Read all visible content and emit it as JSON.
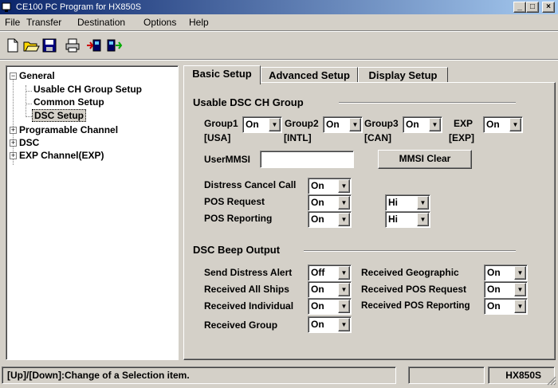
{
  "window": {
    "title": "CE100  PC Program for HX850S"
  },
  "menu": [
    {
      "label": "File"
    },
    {
      "label": "Transfer"
    },
    {
      "label": "Destination"
    },
    {
      "label": "Options"
    },
    {
      "label": "Help"
    }
  ],
  "tree": {
    "general": "General",
    "usable_ch": "Usable CH Group Setup",
    "common": "Common Setup",
    "dsc_setup": "DSC Setup",
    "programable": "Programable Channel",
    "dsc": "DSC",
    "exp": "EXP Channel(EXP)",
    "expander_minus": "−",
    "expander_plus": "+"
  },
  "tabs": {
    "basic": "Basic Setup",
    "advanced": "Advanced Setup",
    "display": "Display Setup"
  },
  "usable_group": {
    "title": "Usable DSC CH Group",
    "group1_label": "Group1",
    "group1_value": "On",
    "group1_sub": "[USA]",
    "group2_label": "Group2",
    "group2_value": "On",
    "group2_sub": "[INTL]",
    "group3_label": "Group3",
    "group3_value": "On",
    "group3_sub": "[CAN]",
    "exp_label": "EXP",
    "exp_value": "On",
    "exp_sub": "[EXP]"
  },
  "mmsi": {
    "label": "UserMMSI",
    "value": "",
    "clear_button": "MMSI Clear"
  },
  "settings": {
    "distress_cancel_label": "Distress Cancel Call",
    "distress_cancel_value": "On",
    "pos_request_label": "POS Request",
    "pos_request_value": "On",
    "pos_request_level": "Hi",
    "pos_reporting_label": "POS Reporting",
    "pos_reporting_value": "On",
    "pos_reporting_level": "Hi"
  },
  "beep": {
    "title": "DSC Beep Output",
    "send_distress_label": "Send Distress Alert",
    "send_distress_value": "Off",
    "all_ships_label": "Received All Ships",
    "all_ships_value": "On",
    "individual_label": "Received Individual",
    "individual_value": "On",
    "group_label": "Received Group",
    "group_value": "On",
    "geographic_label": "Received Geographic",
    "geographic_value": "On",
    "pos_request_label": "Received POS Request",
    "pos_request_value": "On",
    "pos_reporting_label": "Received POS Reporting",
    "pos_reporting_value": "On"
  },
  "status": {
    "hint": "[Up]/[Down]:Change of a Selection item.",
    "model": "HX850S"
  },
  "icons": {
    "arrow": "▼",
    "minimize": "_",
    "maximize": "□",
    "close": "×"
  }
}
